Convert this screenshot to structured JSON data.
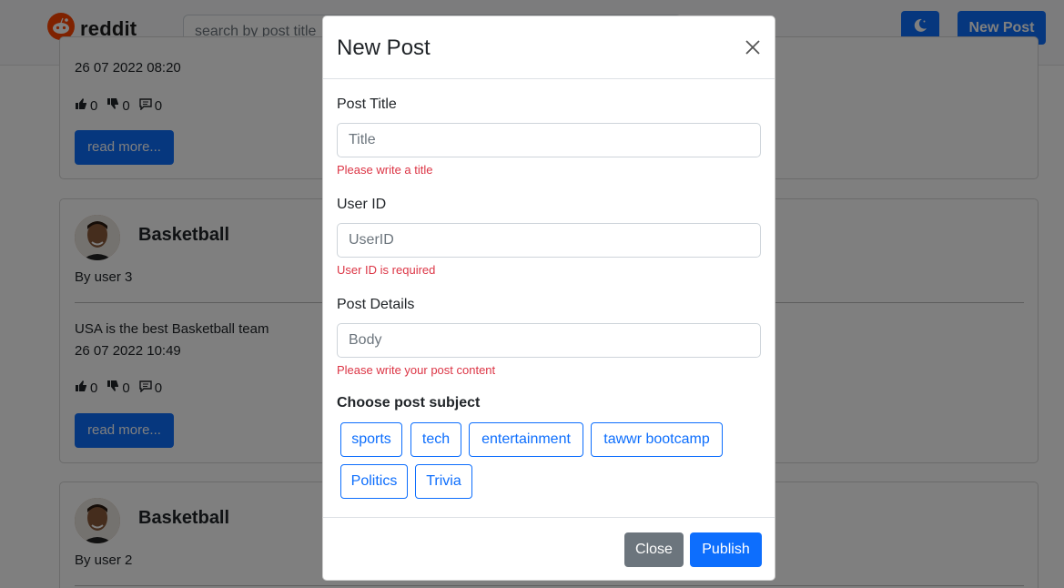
{
  "navbar": {
    "logo_text": "reddit",
    "search_placeholder": "search by post title",
    "new_post_label": "New Post"
  },
  "feed": {
    "card1": {
      "date": "26 07 2022 08:20",
      "likes": "0",
      "dislikes": "0",
      "comments": "0",
      "read_more": "read more..."
    },
    "card2": {
      "title": "Basketball",
      "author": "By user 3",
      "body": "USA is the best Basketball team",
      "date": "26 07 2022 10:49",
      "likes": "0",
      "dislikes": "0",
      "comments": "0",
      "read_more": "read more..."
    },
    "card3": {
      "title": "Basketball",
      "author": "By user 2"
    }
  },
  "modal": {
    "title": "New Post",
    "fields": [
      {
        "label": "Post Title",
        "placeholder": "Title",
        "error": "Please write a title"
      },
      {
        "label": "User ID",
        "placeholder": "UserID",
        "error": "User ID is required"
      },
      {
        "label": "Post Details",
        "placeholder": "Body",
        "error": "Please write your post content"
      }
    ],
    "subject_label": "Choose post subject",
    "subjects": [
      "sports",
      "tech",
      "entertainment",
      "tawwr bootcamp",
      "Politics",
      "Trivia"
    ],
    "close_label": "Close",
    "publish_label": "Publish"
  },
  "colors": {
    "primary": "#0d6efd",
    "secondary": "#6c757d",
    "danger": "#dc3545"
  }
}
